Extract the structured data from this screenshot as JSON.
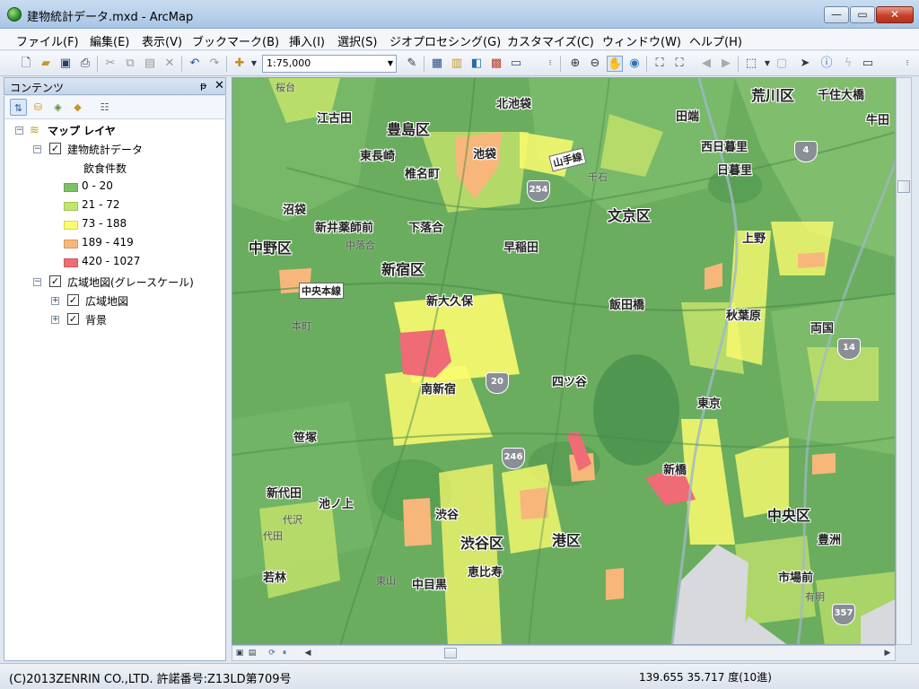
{
  "window": {
    "title": "建物統計データ.mxd - ArcMap",
    "min": "—",
    "max": "▭",
    "close": "✕"
  },
  "menu": [
    "ファイル(F)",
    "編集(E)",
    "表示(V)",
    "ブックマーク(B)",
    "挿入(I)",
    "選択(S)",
    "ジオプロセシング(G)",
    "カスタマイズ(C)",
    "ウィンドウ(W)",
    "ヘルプ(H)"
  ],
  "toolbar": {
    "scale": "1:75,000"
  },
  "toc": {
    "title": "コンテンツ",
    "pin": "ᵽ",
    "close": "✕",
    "root": "マップ レイヤ",
    "layer1": "建物統計データ",
    "field": "飲食件数",
    "classes": [
      {
        "label": "0 - 20",
        "color": "#7ec266"
      },
      {
        "label": "21 - 72",
        "color": "#c5e46b"
      },
      {
        "label": "73 - 188",
        "color": "#fbfb6e"
      },
      {
        "label": "189 - 419",
        "color": "#f8b77a"
      },
      {
        "label": "420 - 1027",
        "color": "#ef6b76"
      }
    ],
    "layer2": "広域地図(グレースケール)",
    "sub1": "広域地図",
    "sub2": "背景"
  },
  "map": {
    "wards": [
      "豊島区",
      "荒川区",
      "文京区",
      "中野区",
      "新宿区",
      "渋谷区",
      "港区",
      "中央区"
    ],
    "places": [
      "江古田",
      "北池袋",
      "田端",
      "千住大橋",
      "牛田",
      "東長崎",
      "池袋",
      "西日暮里",
      "椎名町",
      "日暮里",
      "沼袋",
      "新井薬師前",
      "下落合",
      "早稲田",
      "上野",
      "新大久保",
      "飯田橋",
      "秋葉原",
      "両国",
      "南新宿",
      "四ツ谷",
      "東京",
      "笹塚",
      "新橋",
      "新代田",
      "池ノ上",
      "渋谷",
      "恵比寿",
      "中目黒",
      "若林",
      "豊洲",
      "市場前"
    ],
    "minor": [
      "桜台",
      "千石",
      "中落合",
      "本町",
      "代田",
      "代沢",
      "東山",
      "有明"
    ],
    "rail": [
      "山手線",
      "中央本線"
    ],
    "routes": [
      "4",
      "254",
      "20",
      "14",
      "246",
      "357"
    ]
  },
  "status": {
    "copyright": "(C)2013ZENRIN CO.,LTD. 許諾番号:Z13LD第709号",
    "coords": "139.655  35.717 度(10進)"
  }
}
